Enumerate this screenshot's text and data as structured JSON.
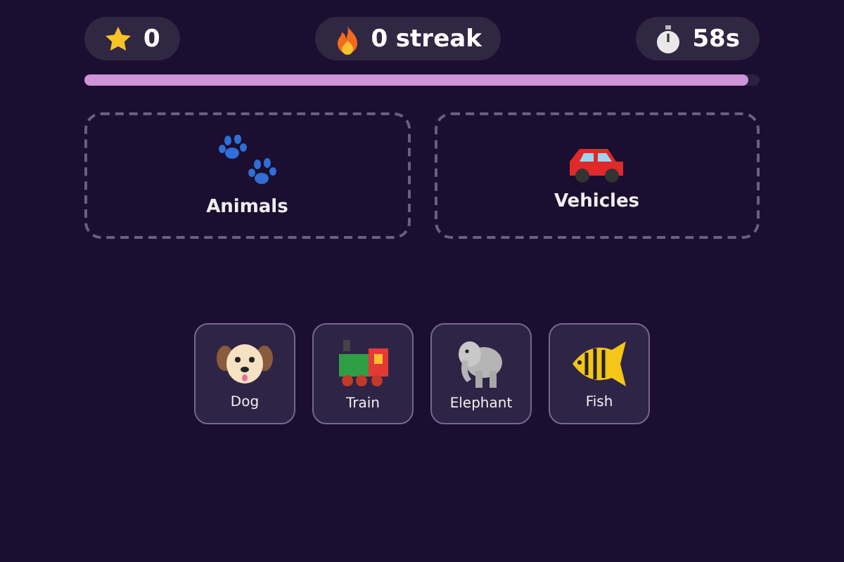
{
  "stats": [
    {
      "value": "0"
    },
    {
      "value": "0 streak"
    },
    {
      "value": "58s"
    }
  ],
  "progress": {
    "level": 0.983
  },
  "categories": [
    {
      "label": "Animals"
    },
    {
      "label": "Vehicles"
    }
  ],
  "cards": [
    {
      "label": "Dog"
    },
    {
      "label": "Train"
    },
    {
      "label": "Elephant"
    },
    {
      "label": "Fish"
    }
  ]
}
